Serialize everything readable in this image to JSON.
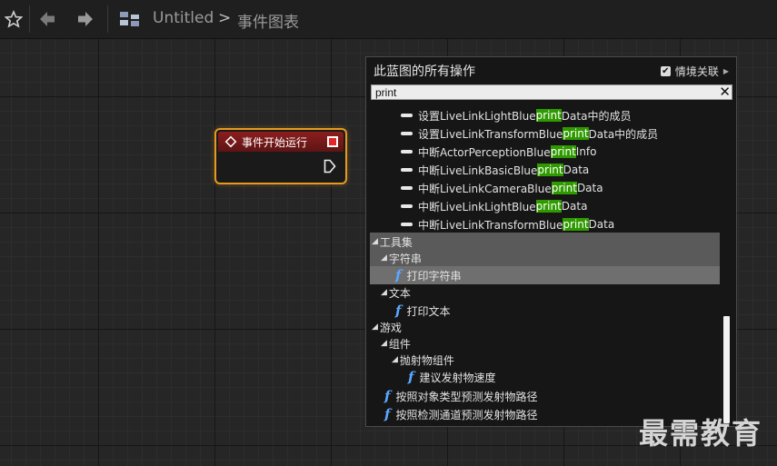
{
  "toolbar": {
    "breadcrumb_root": "Untitled",
    "breadcrumb_sep": ">",
    "breadcrumb_current": "事件图表"
  },
  "node": {
    "title": "事件开始运行"
  },
  "panel": {
    "title": "此蓝图的所有操作",
    "context_label": "情境关联",
    "context_checked": true,
    "search_value": "print"
  },
  "list": [
    {
      "kind": "var",
      "pre": "设置LiveLinkLightBlue",
      "hl": "print",
      "post": "Data中的成员"
    },
    {
      "kind": "var",
      "pre": "设置LiveLinkTransformBlue",
      "hl": "print",
      "post": "Data中的成员"
    },
    {
      "kind": "var",
      "pre": "中断ActorPerceptionBlue",
      "hl": "print",
      "post": "Info"
    },
    {
      "kind": "var",
      "pre": "中断LiveLinkBasicBlue",
      "hl": "print",
      "post": "Data"
    },
    {
      "kind": "var",
      "pre": "中断LiveLinkCameraBlue",
      "hl": "print",
      "post": "Data"
    },
    {
      "kind": "var",
      "pre": "中断LiveLinkLightBlue",
      "hl": "print",
      "post": "Data"
    },
    {
      "kind": "var",
      "pre": "中断LiveLinkTransformBlue",
      "hl": "print",
      "post": "Data"
    },
    {
      "kind": "cat",
      "label": "工具集",
      "level": 0,
      "hdr": true
    },
    {
      "kind": "cat",
      "label": "字符串",
      "level": 1,
      "hdr": true
    },
    {
      "kind": "fn",
      "label": "打印字符串",
      "level": 2,
      "sel": true
    },
    {
      "kind": "cat",
      "label": "文本",
      "level": 1
    },
    {
      "kind": "fn",
      "label": "打印文本",
      "level": 2
    },
    {
      "kind": "cat",
      "label": "游戏",
      "level": 0
    },
    {
      "kind": "cat",
      "label": "组件",
      "level": 1
    },
    {
      "kind": "cat",
      "label": "抛射物组件",
      "level": 2
    },
    {
      "kind": "fn",
      "label": "建议发射物速度",
      "level": 3
    },
    {
      "kind": "fn",
      "label": "按照对象类型预测发射物路径",
      "level": 1
    },
    {
      "kind": "fn",
      "label": "按照检测通道预测发射物路径",
      "level": 1
    }
  ],
  "watermark": "最需教育"
}
